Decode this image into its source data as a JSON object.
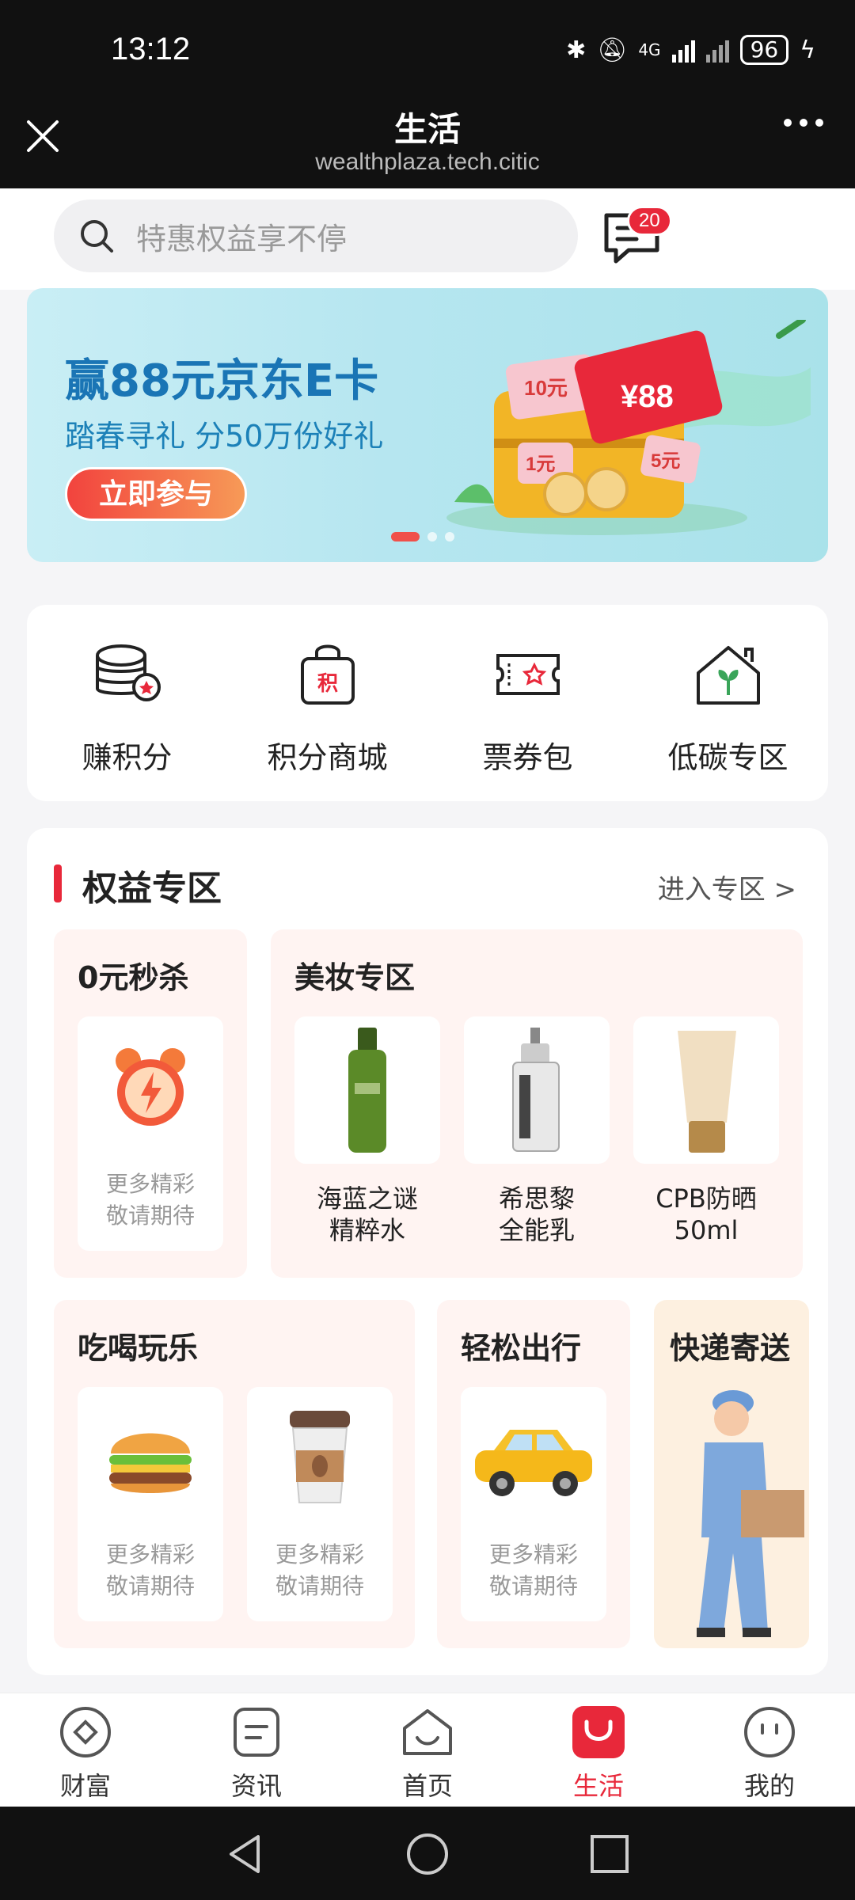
{
  "status": {
    "time": "13:12",
    "battery": "96",
    "network": "4G"
  },
  "header": {
    "title": "生活",
    "url": "wealthplaza.tech.citic"
  },
  "search": {
    "placeholder": "特惠权益享不停",
    "message_count": "20"
  },
  "banner": {
    "title": "赢88元京东E卡",
    "subtitle": "踏春寻礼  分50万份好礼",
    "button": "立即参与",
    "card_value": "¥88",
    "tags": [
      "10元",
      "1元",
      "5元"
    ]
  },
  "quick_menu": [
    {
      "label": "赚积分",
      "icon": "coin-stack-icon"
    },
    {
      "label": "积分商城",
      "icon": "points-bag-icon"
    },
    {
      "label": "票券包",
      "icon": "ticket-icon"
    },
    {
      "label": "低碳专区",
      "icon": "green-house-icon"
    }
  ],
  "rights": {
    "title": "权益专区",
    "enter": "进入专区 >",
    "flash": {
      "title": "0元秒杀",
      "soon": [
        "更多精彩",
        "敬请期待"
      ]
    },
    "beauty": {
      "title": "美妆专区",
      "items": [
        {
          "line1": "海蓝之谜",
          "line2": "精粹水"
        },
        {
          "line1": "希思黎",
          "line2": "全能乳"
        },
        {
          "line1": "CPB防晒",
          "line2": "50ml"
        }
      ]
    },
    "food": {
      "title": "吃喝玩乐",
      "soon": [
        "更多精彩",
        "敬请期待"
      ]
    },
    "travel": {
      "title": "轻松出行",
      "soon": [
        "更多精彩",
        "敬请期待"
      ]
    },
    "express": {
      "title": "快递寄送"
    }
  },
  "nav": [
    {
      "label": "财富",
      "icon": "wealth-icon"
    },
    {
      "label": "资讯",
      "icon": "news-icon"
    },
    {
      "label": "首页",
      "icon": "home-icon"
    },
    {
      "label": "生活",
      "icon": "life-icon"
    },
    {
      "label": "我的",
      "icon": "profile-icon"
    }
  ],
  "colors": {
    "accent": "#e8283a",
    "banner_blue": "#1a75b5"
  }
}
